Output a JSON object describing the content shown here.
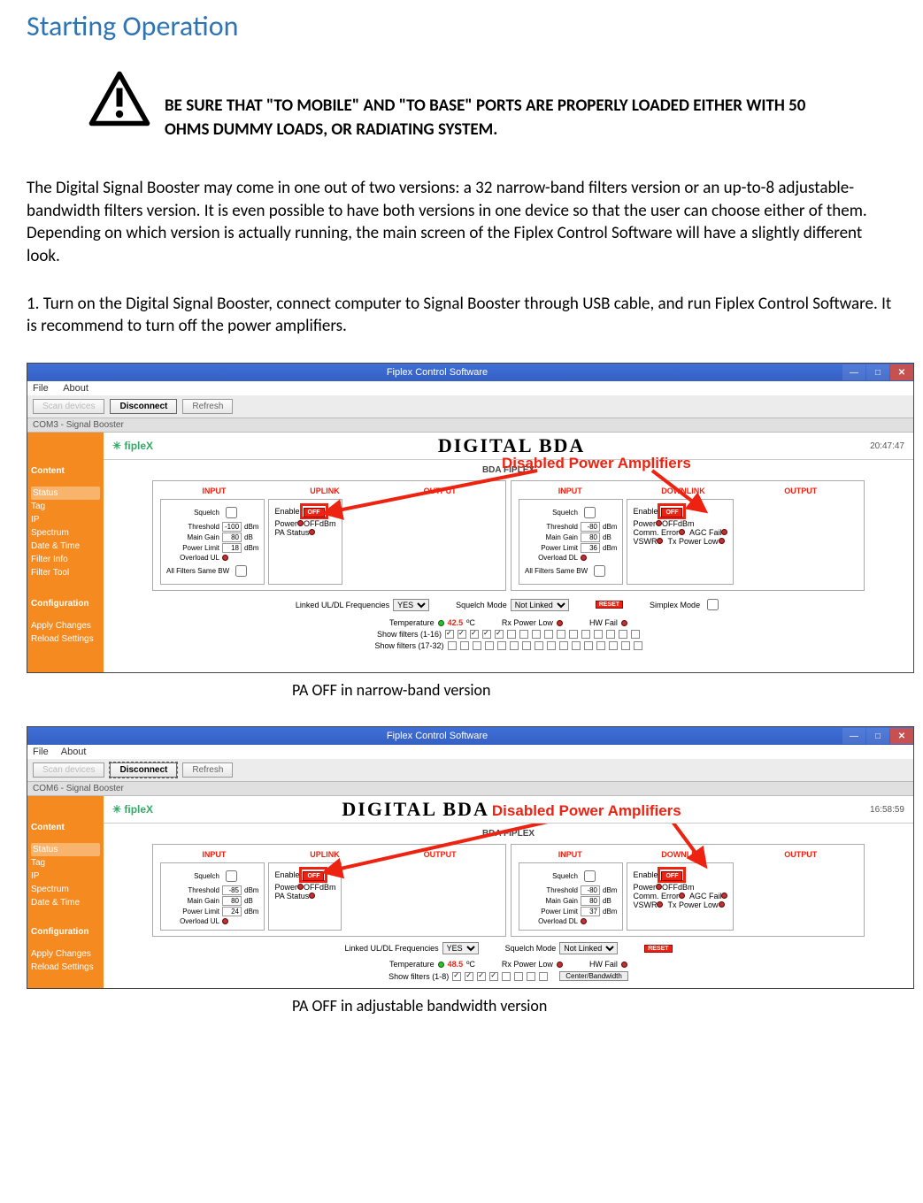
{
  "section_heading": "Starting Operation",
  "warning_text": "BE SURE THAT \"TO MOBILE\" AND \"TO BASE\" PORTS ARE PROPERLY LOADED EITHER WITH 50 OHMS DUMMY LOADS, OR RADIATING SYSTEM.",
  "intro_para": "The Digital Signal Booster may come in one out of two versions: a 32 narrow-band filters version or an up-to-8 adjustable-bandwidth filters version. It is even possible to have both versions in one device so that the user can choose either of them. Depending on which version is actually running, the main screen of the Fiplex Control Software will have a slightly different look.",
  "step1_para": "1. Turn on the Digital Signal Booster, connect computer to Signal Booster through USB cable, and run Fiplex Control Software. It is recommend to turn off the power amplifiers.",
  "caption1": "PA OFF in narrow-band version",
  "caption2": "PA OFF in adjustable bandwidth version",
  "app": {
    "title": "Fiplex Control Software",
    "menu_file": "File",
    "menu_about": "About",
    "btn_scan": "Scan devices",
    "btn_disconnect": "Disconnect",
    "btn_refresh": "Refresh",
    "brand": "fipleX",
    "main_title": "DIGITAL BDA",
    "subtitle": "BDA FIPLEX",
    "annotation": "Disabled Power Amplifiers"
  },
  "shot1": {
    "tab": "COM3 - Signal Booster",
    "clock": "20:47:47",
    "sidebar": {
      "group1": "Content",
      "items1": [
        "Status",
        "Tag",
        "IP",
        "Spectrum",
        "Date & Time",
        "Filter Info",
        "Filter Tool"
      ],
      "group2": "Configuration",
      "items2": [
        "Apply Changes",
        "Reload Settings"
      ]
    },
    "uplink": {
      "label": "UPLINK",
      "input_hdr": "INPUT",
      "output_hdr": "OUTPUT",
      "squelch": "Squelch",
      "threshold_label": "Threshold",
      "threshold_val": "-100",
      "threshold_unit": "dBm",
      "maingain_label": "Main Gain",
      "maingain_val": "80",
      "maingain_unit": "dB",
      "powerlimit_label": "Power Limit",
      "powerlimit_val": "18",
      "powerlimit_unit": "dBm",
      "overload_label": "Overload UL",
      "allfilters_label": "All Filters Same BW",
      "enable_label": "Enable",
      "enable_val": "OFF",
      "power_label": "Power",
      "power_val": "OFF",
      "power_unit": "dBm",
      "pastatus_label": "PA Status"
    },
    "downlink": {
      "label": "DOWNLINK",
      "input_hdr": "INPUT",
      "output_hdr": "OUTPUT",
      "squelch": "Squelch",
      "threshold_label": "Threshold",
      "threshold_val": "-80",
      "threshold_unit": "dBm",
      "maingain_label": "Main Gain",
      "maingain_val": "80",
      "maingain_unit": "dB",
      "powerlimit_label": "Power Limit",
      "powerlimit_val": "36",
      "powerlimit_unit": "dBm",
      "overload_label": "Overload DL",
      "allfilters_label": "All Filters Same BW",
      "enable_label": "Enable",
      "enable_val": "OFF",
      "power_label": "Power",
      "power_val": "OFF",
      "power_unit": "dBm",
      "commerr_label": "Comm. Error",
      "vswr_label": "VSWR",
      "agcfail_label": "AGC Fail",
      "txpowlow_label": "Tx Power Low"
    },
    "mid": {
      "linked_label": "Linked UL/DL Frequencies",
      "linked_val": "YES",
      "squelchmode_label": "Squelch Mode",
      "squelchmode_val": "Not Linked",
      "reset": "RESET",
      "simplex_label": "Simplex Mode",
      "temp_label": "Temperature",
      "temp_val": "42.5",
      "temp_unit": "ºC",
      "rxpowlow_label": "Rx Power Low",
      "hwfail_label": "HW Fail",
      "showfilt1_label": "Show filters (1-16)",
      "showfilt2_label": "Show filters (17-32)"
    }
  },
  "shot2": {
    "tab": "COM6 - Signal Booster",
    "clock": "16:58:59",
    "sidebar": {
      "group1": "Content",
      "items1": [
        "Status",
        "Tag",
        "IP",
        "Spectrum",
        "Date & Time"
      ],
      "group2": "Configuration",
      "items2": [
        "Apply Changes",
        "Reload Settings"
      ]
    },
    "uplink": {
      "label": "UPLINK",
      "input_hdr": "INPUT",
      "output_hdr": "OUTPUT",
      "squelch": "Squelch",
      "threshold_label": "Threshold",
      "threshold_val": "-85",
      "threshold_unit": "dBm",
      "maingain_label": "Main Gain",
      "maingain_val": "80",
      "maingain_unit": "dB",
      "powerlimit_label": "Power Limit",
      "powerlimit_val": "24",
      "powerlimit_unit": "dBm",
      "overload_label": "Overload UL",
      "enable_label": "Enable",
      "enable_val": "OFF",
      "power_label": "Power",
      "power_val": "OFF",
      "power_unit": "dBm",
      "pastatus_label": "PA Status"
    },
    "downlink": {
      "label": "DOWNLINK",
      "input_hdr": "INPUT",
      "output_hdr": "OUTPUT",
      "squelch": "Squelch",
      "threshold_label": "Threshold",
      "threshold_val": "-80",
      "threshold_unit": "dBm",
      "maingain_label": "Main Gain",
      "maingain_val": "80",
      "maingain_unit": "dB",
      "powerlimit_label": "Power Limit",
      "powerlimit_val": "37",
      "powerlimit_unit": "dBm",
      "overload_label": "Overload DL",
      "enable_label": "Enable",
      "enable_val": "OFF",
      "power_label": "Power",
      "power_val": "OFF",
      "power_unit": "dBm",
      "commerr_label": "Comm. Error",
      "vswr_label": "VSWR",
      "agcfail_label": "AGC Fail",
      "txpowlow_label": "Tx Power Low"
    },
    "mid": {
      "linked_label": "Linked UL/DL Frequencies",
      "linked_val": "YES",
      "squelchmode_label": "Squelch Mode",
      "squelchmode_val": "Not Linked",
      "reset": "RESET",
      "temp_label": "Temperature",
      "temp_val": "48.5",
      "temp_unit": "ºC",
      "rxpowlow_label": "Rx Power Low",
      "hwfail_label": "HW Fail",
      "showfilt1_label": "Show filters (1-8)",
      "centerbw": "Center/Bandwidth"
    }
  }
}
